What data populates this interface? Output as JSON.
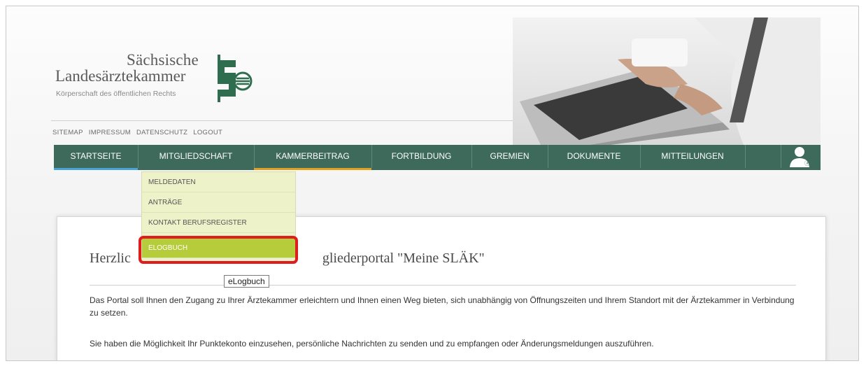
{
  "logo": {
    "line1": "Sächsische",
    "line2": "Landesärztekammer",
    "line3": "Körperschaft des öffentlichen Rechts"
  },
  "meta_links": [
    "SITEMAP",
    "IMPRESSUM",
    "DATENSCHUTZ",
    "LOGOUT"
  ],
  "nav": {
    "items": [
      "STARTSEITE",
      "MITGLIEDSCHAFT",
      "KAMMERBEITRAG",
      "FORTBILDUNG",
      "GREMIEN",
      "DOKUMENTE",
      "MITTEILUNGEN"
    ],
    "user_icon": "user-icon",
    "colors": {
      "bar": "#3d6a5b",
      "startseite_accent": "#4aa3d6",
      "kammerbeitrag_accent": "#e0a020"
    }
  },
  "dropdown": {
    "items": [
      "MELDEDATEN",
      "ANTRÄGE",
      "KONTAKT BERUFSREGISTER",
      "ELOGBUCH"
    ],
    "active": "ELOGBUCH",
    "colors": {
      "bg": "#eef2c9",
      "active": "#b6cc3a"
    }
  },
  "tooltip": "eLogbuch",
  "content": {
    "welcome_visible_left": "Herzlic",
    "welcome_visible_right": "gliederportal \"Meine SLÄK\"",
    "para1": "Das Portal soll Ihnen den Zugang zu Ihrer Ärztekammer erleichtern und Ihnen einen Weg bieten, sich unabhängig von Öffnungszeiten und Ihrem Standort mit der Ärztekammer in Verbindung zu setzen.",
    "para2": "Sie haben die Möglichkeit Ihr Punktekonto einzusehen, persönliche Nachrichten zu senden und zu empfangen oder Änderungsmeldungen auszuführen."
  },
  "highlight_color": "#e01d1d"
}
